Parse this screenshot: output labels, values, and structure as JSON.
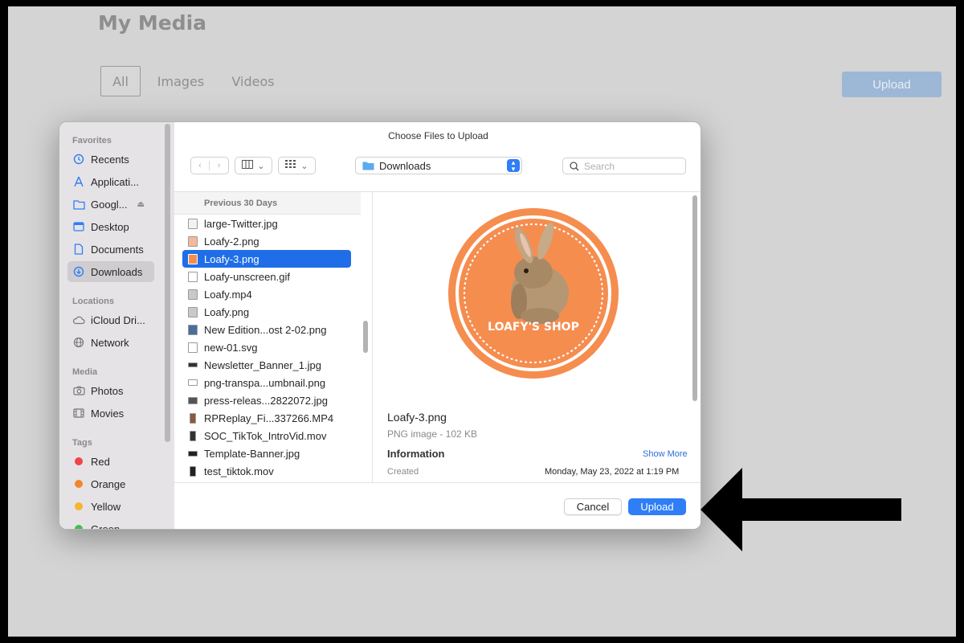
{
  "page": {
    "title": "My Media",
    "tabs": [
      "All",
      "Images",
      "Videos"
    ],
    "upload_label": "Upload"
  },
  "dialog": {
    "title": "Choose Files to Upload",
    "location": "Downloads",
    "search_placeholder": "Search",
    "sidebar": {
      "favorites_label": "Favorites",
      "favorites": [
        {
          "label": "Recents",
          "icon": "clock-icon"
        },
        {
          "label": "Applicati...",
          "icon": "applications-icon"
        },
        {
          "label": "Googl...",
          "icon": "drive-folder-icon"
        },
        {
          "label": "Desktop",
          "icon": "desktop-icon"
        },
        {
          "label": "Documents",
          "icon": "document-icon"
        },
        {
          "label": "Downloads",
          "icon": "download-icon"
        }
      ],
      "locations_label": "Locations",
      "locations": [
        {
          "label": "iCloud Dri...",
          "icon": "cloud-icon"
        },
        {
          "label": "Network",
          "icon": "globe-icon"
        }
      ],
      "media_label": "Media",
      "media": [
        {
          "label": "Photos",
          "icon": "camera-icon"
        },
        {
          "label": "Movies",
          "icon": "film-icon"
        }
      ],
      "tags_label": "Tags",
      "tags": [
        {
          "label": "Red",
          "color": "#f2424a"
        },
        {
          "label": "Orange",
          "color": "#f2862e"
        },
        {
          "label": "Yellow",
          "color": "#f5b52e"
        },
        {
          "label": "Green",
          "color": "#3fbf4f"
        }
      ]
    },
    "files": {
      "section_label": "Previous 30 Days",
      "items": [
        "large-Twitter.jpg",
        "Loafy-2.png",
        "Loafy-3.png",
        "Loafy-unscreen.gif",
        "Loafy.mp4",
        "Loafy.png",
        "New Edition...ost 2-02.png",
        "new-01.svg",
        "Newsletter_Banner_1.jpg",
        "png-transpa...umbnail.png",
        "press-releas...2822072.jpg",
        "RPReplay_Fi...337266.MP4",
        "SOC_TikTok_IntroVid.mov",
        "Template-Banner.jpg",
        "test_tiktok.mov"
      ],
      "selected": "Loafy-3.png"
    },
    "preview": {
      "logo_text": "LOAFY'S SHOP",
      "file_name": "Loafy-3.png",
      "file_type": "PNG image - 102 KB",
      "info_label": "Information",
      "show_more": "Show More",
      "created_label": "Created",
      "created_value": "Monday, May 23, 2022 at 1:19 PM"
    },
    "cancel_label": "Cancel",
    "upload_label": "Upload"
  },
  "colors": {
    "accent": "#2f7ef6",
    "logo_orange": "#f58d4f",
    "selection": "#1f6ee8"
  }
}
